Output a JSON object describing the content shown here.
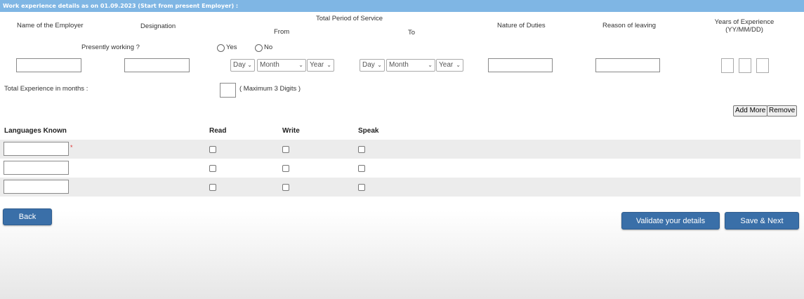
{
  "section_title": "Work experience details as on 01.09.2023 (Start from present Employer) :",
  "columns": {
    "employer": "Name of the Employer",
    "designation": "Designation",
    "total_period": "Total Period of Service",
    "from": "From",
    "to": "To",
    "nature": "Nature of Duties",
    "reason": "Reason of leaving",
    "years_line1": "Years of Experience",
    "years_line2": "(YY/MM/DD)"
  },
  "presently_working": {
    "label": "Presently working ?",
    "yes": "Yes",
    "no": "No"
  },
  "date_selects": {
    "from": {
      "day": "Day",
      "month": "Month",
      "year": "Year"
    },
    "to": {
      "day": "Day",
      "month": "Month",
      "year": "Year"
    }
  },
  "total_experience": {
    "label": "Total Experience in months :",
    "hint": "( Maximum 3 Digits )"
  },
  "buttons": {
    "add_more": "Add More",
    "remove": "Remove",
    "back": "Back",
    "validate": "Validate your details",
    "save_next": "Save & Next"
  },
  "languages": {
    "header": "Languages Known",
    "read": "Read",
    "write": "Write",
    "speak": "Speak",
    "required_mark": "*",
    "rows": 3
  },
  "colors": {
    "header_bar": "#7fb6e4",
    "primary_button": "#3a6fa8",
    "row_shade": "#ececec"
  }
}
